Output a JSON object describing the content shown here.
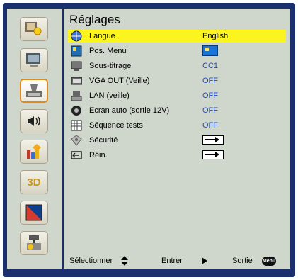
{
  "header": {
    "title": "Réglages"
  },
  "sidebar": {
    "items": [
      {
        "name": "picture",
        "icon": "picture-icon"
      },
      {
        "name": "display",
        "icon": "display-icon"
      },
      {
        "name": "setup",
        "icon": "setup-icon"
      },
      {
        "name": "audio",
        "icon": "audio-icon"
      },
      {
        "name": "options",
        "icon": "options-icon"
      },
      {
        "name": "3d",
        "label": "3D",
        "icon": "3d-icon"
      },
      {
        "name": "image-quality",
        "icon": "image-quality-icon"
      },
      {
        "name": "network",
        "icon": "network-icon"
      }
    ]
  },
  "menu": {
    "rows": [
      {
        "label": "Langue",
        "value": "English",
        "icon": "globe-icon",
        "highlighted": true
      },
      {
        "label": "Pos. Menu",
        "value": "",
        "icon": "menu-position-icon",
        "control": "color-box"
      },
      {
        "label": "Sous-titrage",
        "value": "CC1",
        "icon": "subtitle-icon"
      },
      {
        "label": "VGA OUT (Veille)",
        "value": "OFF",
        "icon": "vga-out-icon"
      },
      {
        "label": "LAN  (veille)",
        "value": "OFF",
        "icon": "lan-icon"
      },
      {
        "label": "Ecran auto (sortie 12V)",
        "value": "OFF",
        "icon": "screen-auto-icon"
      },
      {
        "label": "Séquence tests",
        "value": "OFF",
        "icon": "test-pattern-icon"
      },
      {
        "label": "Sécurité",
        "value": "",
        "icon": "security-icon",
        "control": "arrow"
      },
      {
        "label": "Réin.",
        "value": "",
        "icon": "reset-icon",
        "control": "arrow"
      }
    ]
  },
  "footer": {
    "select_label": "Sélectionner",
    "enter_label": "Entrer",
    "exit_label": "Sortie",
    "menu_badge": "Menu"
  },
  "colors": {
    "highlight": "#fbf41f",
    "frame": "#1a2f6e",
    "panel": "#cfd6cc",
    "value_text": "#1f4bc8",
    "selected_border": "#e38a1e"
  }
}
